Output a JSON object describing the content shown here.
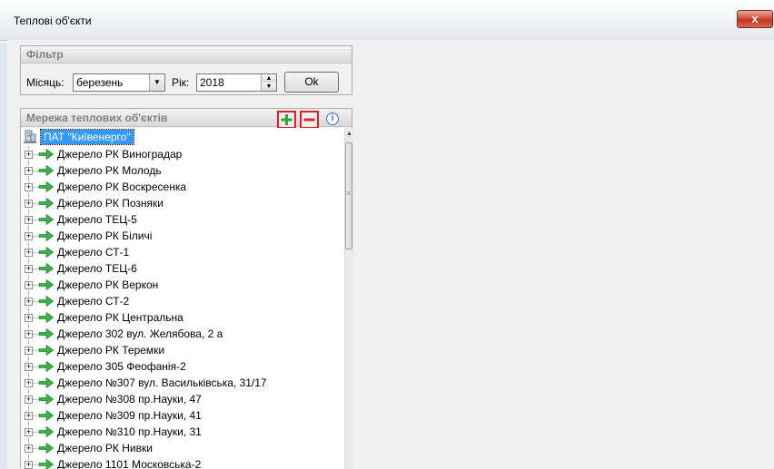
{
  "window": {
    "title": "Теплові об'єкти",
    "close_symbol": "x"
  },
  "filter": {
    "heading": "Фільтр",
    "month_label": "Місяць:",
    "month_value": "березень",
    "year_label": "Рік:",
    "year_value": "2018",
    "ok_label": "Ok"
  },
  "network": {
    "heading": "Мережа теплових об'єктів",
    "add_symbol": "+",
    "remove_symbol": "−",
    "info_symbol": "i",
    "root_label": "ПАТ \"Київенерго\"",
    "items": [
      "Джерело РК Виноградар",
      "Джерело РК Молодь",
      "Джерело РК Воскресенка",
      "Джерело РК Позняки",
      "Джерело ТЕЦ-5",
      "Джерело РК Біличі",
      "Джерело СТ-1",
      "Джерело ТЕЦ-6",
      "Джерело РК Веркон",
      "Джерело СТ-2",
      "Джерело РК Центральна",
      "Джерело 302 вул. Желябова, 2 а",
      "Джерело РК Теремки",
      "Джерело 305 Феофанія-2",
      "Джерело №307 вул. Васильківська, 31/17",
      "Джерело №308 пр.Науки, 47",
      "Джерело №309 пр.Науки, 41",
      "Джерело №310 пр.Науки, 31",
      "Джерело РК Нивки",
      "Джерело 1101 Московська-2"
    ]
  },
  "icons": {
    "tree_expand": "+",
    "scroll_up": "▲",
    "scroll_down": "▼",
    "combo_arrow": "▼",
    "spin_up": "▲",
    "spin_down": "▼",
    "grip": "≡"
  },
  "colors": {
    "selection": "#3399ff",
    "highlight_border": "#e21d2b",
    "arrow_green": "#3cb34a",
    "add_green": "#2fa82f",
    "remove_red": "#d9262b"
  }
}
